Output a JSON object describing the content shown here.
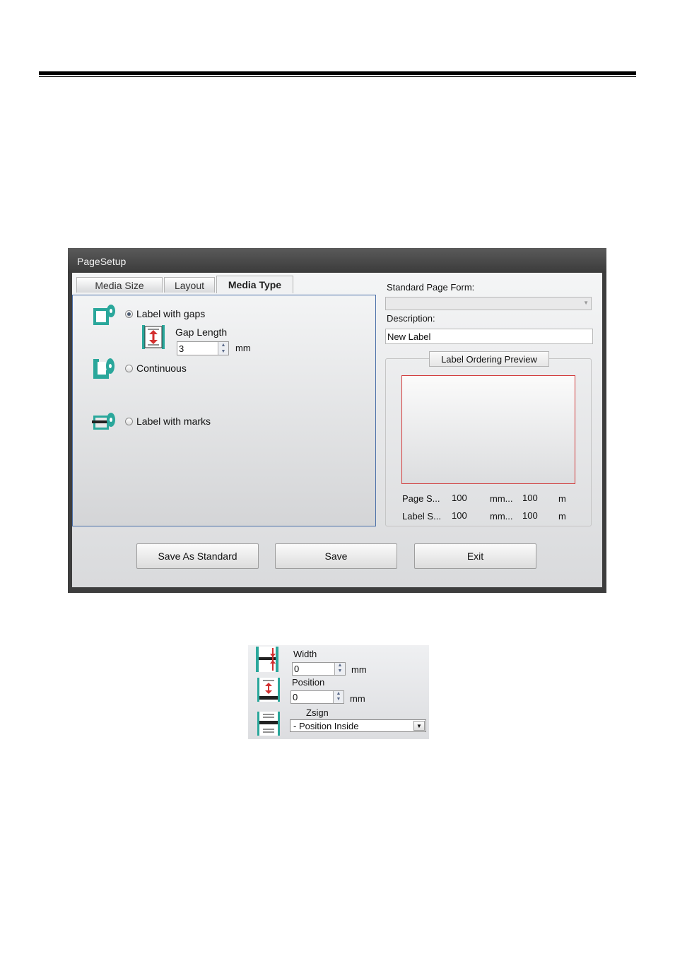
{
  "dialog": {
    "title": "PageSetup",
    "tabs": [
      {
        "label": "Media Size"
      },
      {
        "label": "Layout"
      },
      {
        "label": "Media Type"
      }
    ],
    "media_type": {
      "label_with_gaps": "Label with gaps",
      "gap_length_label": "Gap Length",
      "gap_length_value": "3",
      "gap_unit": "mm",
      "continuous": "Continuous",
      "label_with_marks": "Label with marks"
    },
    "standard_page_form_label": "Standard Page Form:",
    "standard_page_form_value": "",
    "description_label": "Description:",
    "description_value": "New Label",
    "preview": {
      "title": "Label Ordering Preview",
      "rows": [
        {
          "label": "Page S...",
          "v1": "100",
          "unit1": "mm...",
          "v2": "100",
          "unit2": "m"
        },
        {
          "label": "Label S...",
          "v1": "100",
          "unit1": "mm...",
          "v2": "100",
          "unit2": "m"
        }
      ]
    },
    "buttons": {
      "save_as_standard": "Save As Standard",
      "save": "Save",
      "exit": "Exit"
    }
  },
  "marks_panel": {
    "width_label": "Width",
    "width_value": "0",
    "width_unit": "mm",
    "position_label": "Position",
    "position_value": "0",
    "position_unit": "mm",
    "zsign_label": "Zsign",
    "zsign_value": "- Position Inside"
  },
  "colors": {
    "teal": "#2aa79b",
    "red": "#d32f2f",
    "panel_border": "#4a6fa8"
  }
}
